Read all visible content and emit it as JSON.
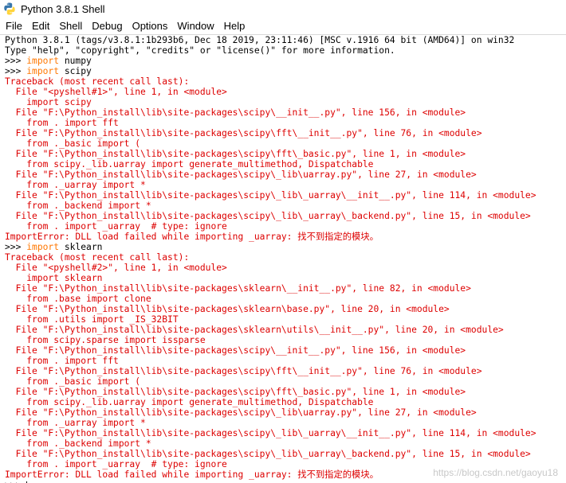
{
  "window": {
    "title": "Python 3.8.1 Shell",
    "icon": "python-icon"
  },
  "menu": [
    "File",
    "Edit",
    "Shell",
    "Debug",
    "Options",
    "Window",
    "Help"
  ],
  "lines": [
    {
      "t": "out",
      "text": "Python 3.8.1 (tags/v3.8.1:1b293b6, Dec 18 2019, 23:11:46) [MSC v.1916 64 bit (AMD64)] on win32"
    },
    {
      "t": "out",
      "text": "Type \"help\", \"copyright\", \"credits\" or \"license()\" for more information."
    },
    {
      "t": "cmd",
      "prompt": ">>> ",
      "kw": "import",
      "rest": " numpy"
    },
    {
      "t": "cmd",
      "prompt": ">>> ",
      "kw": "import",
      "rest": " scipy"
    },
    {
      "t": "err",
      "text": "Traceback (most recent call last):"
    },
    {
      "t": "err",
      "text": "  File \"<pyshell#1>\", line 1, in <module>"
    },
    {
      "t": "err",
      "text": "    import scipy"
    },
    {
      "t": "err",
      "text": "  File \"F:\\Python_install\\lib\\site-packages\\scipy\\__init__.py\", line 156, in <module>"
    },
    {
      "t": "err",
      "text": "    from . import fft"
    },
    {
      "t": "err",
      "text": "  File \"F:\\Python_install\\lib\\site-packages\\scipy\\fft\\__init__.py\", line 76, in <module>"
    },
    {
      "t": "err",
      "text": "    from ._basic import ("
    },
    {
      "t": "err",
      "text": "  File \"F:\\Python_install\\lib\\site-packages\\scipy\\fft\\_basic.py\", line 1, in <module>"
    },
    {
      "t": "err",
      "text": "    from scipy._lib.uarray import generate_multimethod, Dispatchable"
    },
    {
      "t": "err",
      "text": "  File \"F:\\Python_install\\lib\\site-packages\\scipy\\_lib\\uarray.py\", line 27, in <module>"
    },
    {
      "t": "err",
      "text": "    from ._uarray import *"
    },
    {
      "t": "err",
      "text": "  File \"F:\\Python_install\\lib\\site-packages\\scipy\\_lib\\_uarray\\__init__.py\", line 114, in <module>"
    },
    {
      "t": "err",
      "text": "    from ._backend import *"
    },
    {
      "t": "err",
      "text": "  File \"F:\\Python_install\\lib\\site-packages\\scipy\\_lib\\_uarray\\_backend.py\", line 15, in <module>"
    },
    {
      "t": "err",
      "text": "    from . import _uarray  # type: ignore"
    },
    {
      "t": "err",
      "text": "ImportError: DLL load failed while importing _uarray: 找不到指定的模块。"
    },
    {
      "t": "cmd",
      "prompt": ">>> ",
      "kw": "import",
      "rest": " sklearn"
    },
    {
      "t": "err",
      "text": "Traceback (most recent call last):"
    },
    {
      "t": "err",
      "text": "  File \"<pyshell#2>\", line 1, in <module>"
    },
    {
      "t": "err",
      "text": "    import sklearn"
    },
    {
      "t": "err",
      "text": "  File \"F:\\Python_install\\lib\\site-packages\\sklearn\\__init__.py\", line 82, in <module>"
    },
    {
      "t": "err",
      "text": "    from .base import clone"
    },
    {
      "t": "err",
      "text": "  File \"F:\\Python_install\\lib\\site-packages\\sklearn\\base.py\", line 20, in <module>"
    },
    {
      "t": "err",
      "text": "    from .utils import _IS_32BIT"
    },
    {
      "t": "err",
      "text": "  File \"F:\\Python_install\\lib\\site-packages\\sklearn\\utils\\__init__.py\", line 20, in <module>"
    },
    {
      "t": "err",
      "text": "    from scipy.sparse import issparse"
    },
    {
      "t": "err",
      "text": "  File \"F:\\Python_install\\lib\\site-packages\\scipy\\__init__.py\", line 156, in <module>"
    },
    {
      "t": "err",
      "text": "    from . import fft"
    },
    {
      "t": "err",
      "text": "  File \"F:\\Python_install\\lib\\site-packages\\scipy\\fft\\__init__.py\", line 76, in <module>"
    },
    {
      "t": "err",
      "text": "    from ._basic import ("
    },
    {
      "t": "err",
      "text": "  File \"F:\\Python_install\\lib\\site-packages\\scipy\\fft\\_basic.py\", line 1, in <module>"
    },
    {
      "t": "err",
      "text": "    from scipy._lib.uarray import generate_multimethod, Dispatchable"
    },
    {
      "t": "err",
      "text": "  File \"F:\\Python_install\\lib\\site-packages\\scipy\\_lib\\uarray.py\", line 27, in <module>"
    },
    {
      "t": "err",
      "text": "    from ._uarray import *"
    },
    {
      "t": "err",
      "text": "  File \"F:\\Python_install\\lib\\site-packages\\scipy\\_lib\\_uarray\\__init__.py\", line 114, in <module>"
    },
    {
      "t": "err",
      "text": "    from ._backend import *"
    },
    {
      "t": "err",
      "text": "  File \"F:\\Python_install\\lib\\site-packages\\scipy\\_lib\\_uarray\\_backend.py\", line 15, in <module>"
    },
    {
      "t": "err",
      "text": "    from . import _uarray  # type: ignore"
    },
    {
      "t": "err",
      "text": "ImportError: DLL load failed while importing _uarray: 找不到指定的模块。"
    },
    {
      "t": "cmd",
      "prompt": ">>> ",
      "kw": "",
      "rest": ""
    }
  ],
  "watermark": "https://blog.csdn.net/gaoyu18",
  "colors": {
    "keyword": "#ff7700",
    "error": "#dd0000",
    "text": "#000000",
    "background": "#ffffff"
  }
}
